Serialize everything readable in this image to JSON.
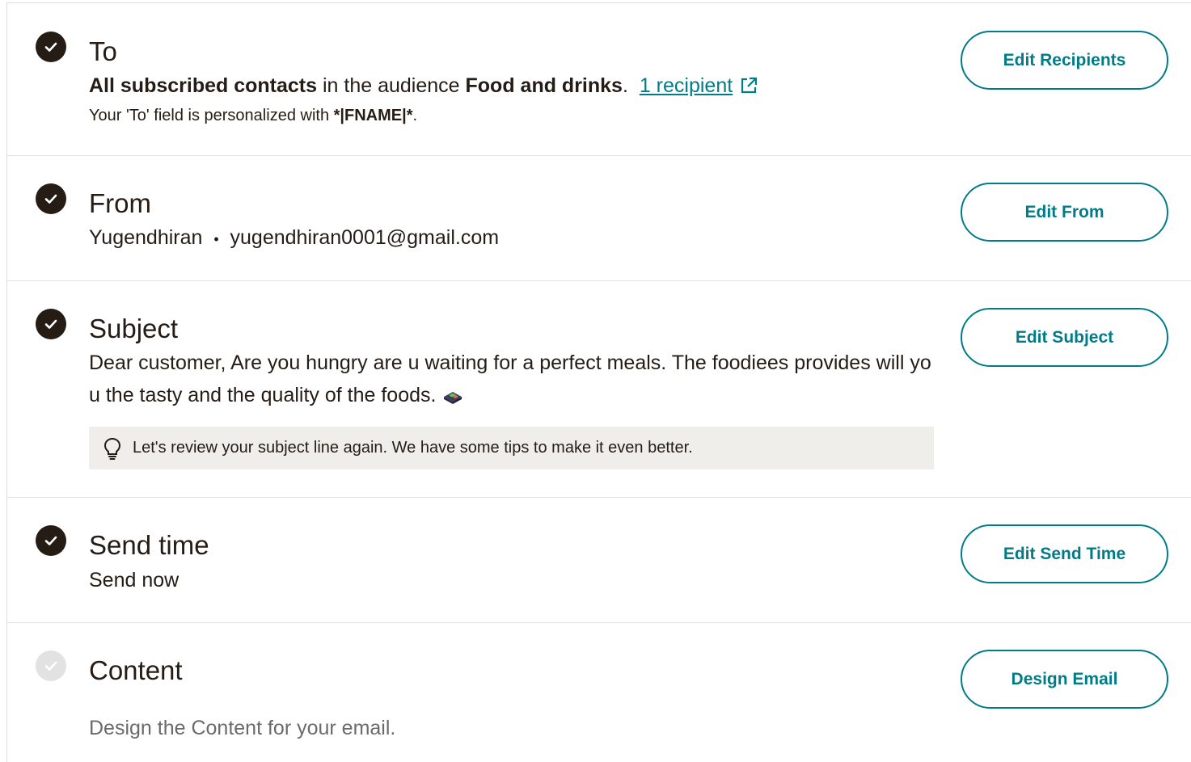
{
  "to": {
    "title": "To",
    "bold_recipients": "All subscribed contacts",
    "middle_text": " in the audience ",
    "audience": "Food and drinks",
    "period": ".",
    "recipients_link": "1 recipient",
    "personalized_prefix": "Your 'To' field is personalized with ",
    "merge_tag": "*|FNAME|*",
    "personalized_suffix": ".",
    "button": "Edit Recipients"
  },
  "from": {
    "title": "From",
    "name": "Yugendhiran",
    "separator": "•",
    "email": "yugendhiran0001@gmail.com",
    "button": "Edit From"
  },
  "subject": {
    "title": "Subject",
    "text": "Dear customer, Are you hungry are u waiting for a perfect meals. The foodiees provides will you the tasty and the quality of the foods.",
    "tip": "Let's review your subject line again. We have some tips to make it even better.",
    "button": "Edit Subject"
  },
  "send_time": {
    "title": "Send time",
    "value": "Send now",
    "button": "Edit Send Time"
  },
  "content": {
    "title": "Content",
    "description": "Design the Content for your email.",
    "button": "Design Email"
  },
  "icons": {
    "check": "check-circle-icon",
    "external": "external-link-icon",
    "lightbulb": "lightbulb-icon"
  },
  "colors": {
    "accent": "#007c89",
    "dark": "#241c15",
    "tip_bg": "#efeeea",
    "pending": "#e2e2e2"
  }
}
